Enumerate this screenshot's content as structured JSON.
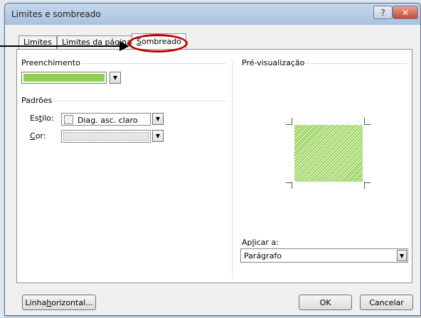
{
  "dialog": {
    "title": "Limites e sombreado",
    "help_glyph": "?",
    "close_glyph": "✕"
  },
  "tabs": [
    {
      "pre": "Limi",
      "ul": "t",
      "post": "es"
    },
    {
      "pre": "Limites da ",
      "ul": "p",
      "post": "ágina"
    },
    {
      "pre": "",
      "ul": "S",
      "post": "ombreado"
    }
  ],
  "fill": {
    "label": "Preenchimento",
    "color": "#92d050"
  },
  "patterns": {
    "label": "Padrões",
    "style_label": {
      "pre": "Es",
      "ul": "t",
      "post": "ilo:"
    },
    "style_value": "Diag. asc. claro",
    "color_label": {
      "pre": "",
      "ul": "C",
      "post": "or:"
    },
    "color_value": ""
  },
  "preview": {
    "label": "Pré-visualização",
    "apply_label": {
      "pre": "Ap",
      "ul": "l",
      "post": "icar a:"
    },
    "apply_value": "Parágrafo"
  },
  "buttons": {
    "horizontal_line": {
      "pre": "Linha ",
      "ul": "h",
      "post": "orizontal..."
    },
    "ok": "OK",
    "cancel": "Cancelar"
  },
  "dropdown_glyph": "▼"
}
